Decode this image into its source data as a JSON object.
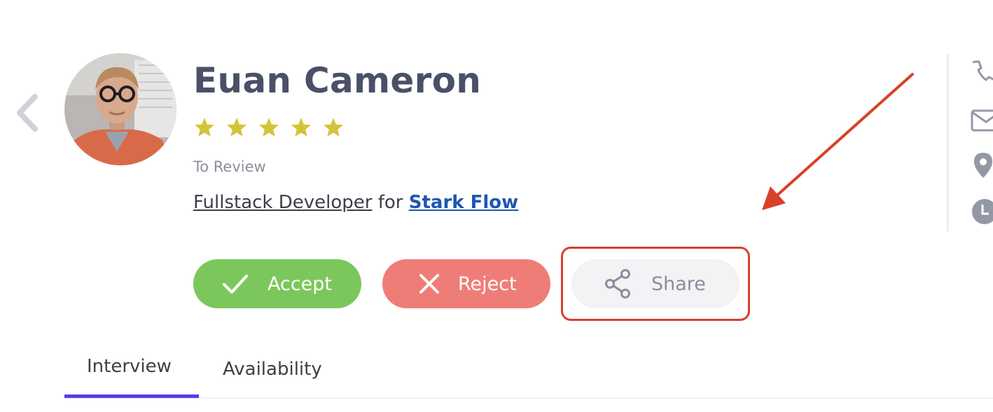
{
  "candidate": {
    "name": "Euan Cameron",
    "status": "To Review",
    "role": "Fullstack Developer",
    "connector": "for",
    "company": "Stark Flow",
    "rating": 5,
    "rating_max": 5
  },
  "actions": {
    "accept_label": "Accept",
    "reject_label": "Reject",
    "share_label": "Share"
  },
  "tabs": [
    {
      "label": "Interview",
      "active": true
    },
    {
      "label": "Availability",
      "active": false
    }
  ],
  "contact_icons": [
    "phone-icon",
    "mail-icon",
    "location-pin-icon",
    "clock-icon"
  ],
  "colors": {
    "accept": "#7cc75c",
    "reject": "#ef7d77",
    "share_bg": "#f3f3f5",
    "star": "#d4c43a",
    "company_link": "#1f56b5",
    "active_tab": "#5b3be8",
    "annotation": "#d8402a"
  }
}
